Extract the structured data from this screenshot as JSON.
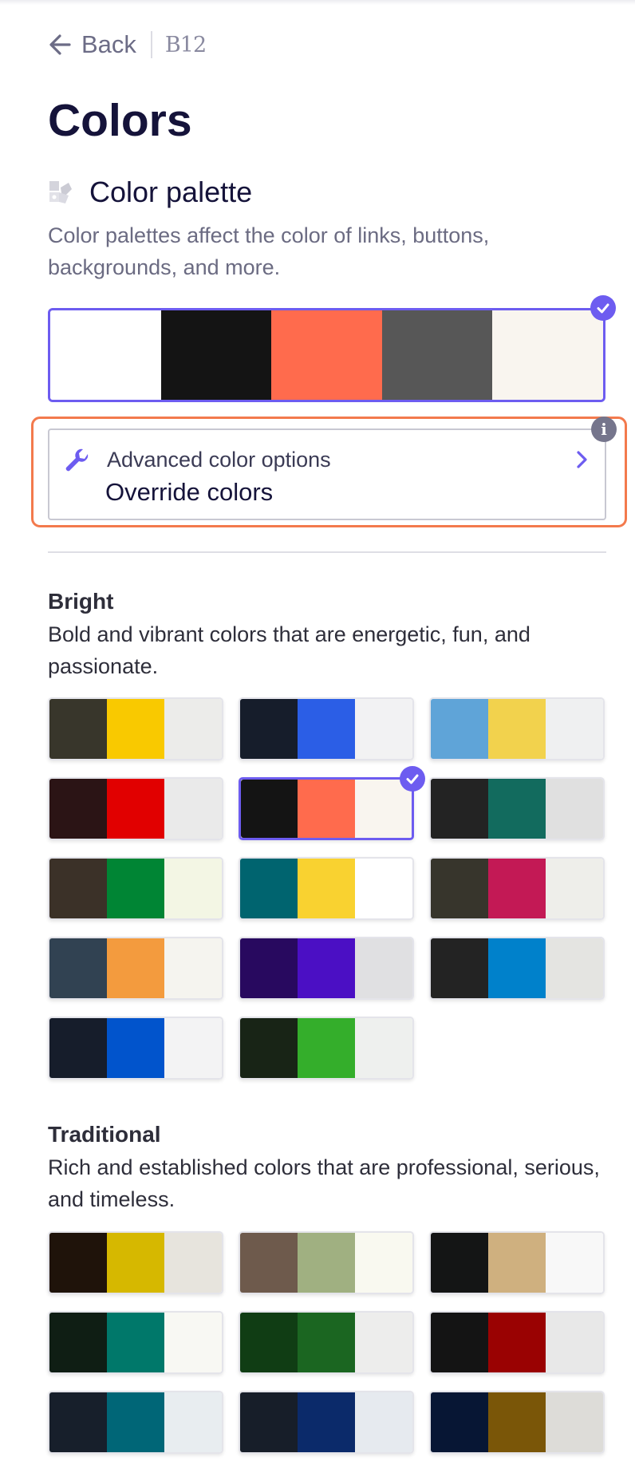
{
  "nav": {
    "back_label": "Back",
    "logo": "B12"
  },
  "page": {
    "title": "Colors"
  },
  "palette_section": {
    "icon": "paint-swatch-icon",
    "title": "Color palette",
    "description": "Color palettes affect the color of links, buttons, backgrounds, and more.",
    "selected_palette": [
      "#ffffff",
      "#141414",
      "#ff6b4d",
      "#575757",
      "#f9f5ef"
    ]
  },
  "advanced": {
    "icon": "wrench-icon",
    "label": "Advanced color options",
    "value": "Override colors",
    "info_icon": "i"
  },
  "groups": [
    {
      "title": "Bright",
      "description": "Bold and vibrant colors that are energetic, fun, and passionate.",
      "palettes": [
        {
          "colors": [
            "#38362b",
            "#f9c900",
            "#ececea"
          ],
          "selected": false
        },
        {
          "colors": [
            "#161d2b",
            "#2b5ee6",
            "#f2f2f3"
          ],
          "selected": false
        },
        {
          "colors": [
            "#5fa4d8",
            "#f2d24d",
            "#eff0f1"
          ],
          "selected": false
        },
        {
          "colors": [
            "#2b1415",
            "#e10000",
            "#eaeaea"
          ],
          "selected": false
        },
        {
          "colors": [
            "#141414",
            "#ff6b4d",
            "#f9f5ef"
          ],
          "selected": true
        },
        {
          "colors": [
            "#232323",
            "#126b5e",
            "#e0e0e0"
          ],
          "selected": false
        },
        {
          "colors": [
            "#3b3128",
            "#008534",
            "#f3f6e4"
          ],
          "selected": false
        },
        {
          "colors": [
            "#00646f",
            "#f9d230",
            "#ffffff"
          ],
          "selected": false
        },
        {
          "colors": [
            "#37352c",
            "#c31955",
            "#eeeeea"
          ],
          "selected": false
        },
        {
          "colors": [
            "#314252",
            "#f39b3e",
            "#f5f4ef"
          ],
          "selected": false
        },
        {
          "colors": [
            "#28095f",
            "#4b0fc4",
            "#e0e0e2"
          ],
          "selected": false
        },
        {
          "colors": [
            "#232323",
            "#0081cb",
            "#e4e4e1"
          ],
          "selected": false
        },
        {
          "colors": [
            "#161d2b",
            "#0154cc",
            "#f3f3f4"
          ],
          "selected": false
        },
        {
          "colors": [
            "#182416",
            "#34ae2b",
            "#eef0ee"
          ],
          "selected": false
        }
      ]
    },
    {
      "title": "Traditional",
      "description": "Rich and established colors that are professional, serious, and timeless.",
      "palettes": [
        {
          "colors": [
            "#1f130a",
            "#d6b800",
            "#e7e4dd"
          ],
          "selected": false
        },
        {
          "colors": [
            "#6e5a4c",
            "#a0b081",
            "#f9f9f0"
          ],
          "selected": false
        },
        {
          "colors": [
            "#141515",
            "#cfb07f",
            "#f8f8f8"
          ],
          "selected": false
        },
        {
          "colors": [
            "#0f1e14",
            "#00786a",
            "#f8f8f3"
          ],
          "selected": false
        },
        {
          "colors": [
            "#103d14",
            "#1b6621",
            "#ededec"
          ],
          "selected": false
        },
        {
          "colors": [
            "#141414",
            "#9a0202",
            "#e8e8e8"
          ],
          "selected": false
        },
        {
          "colors": [
            "#171f2b",
            "#006677",
            "#e8edf0"
          ],
          "selected": false
        },
        {
          "colors": [
            "#171e29",
            "#0b2a6a",
            "#e6eaef"
          ],
          "selected": false
        },
        {
          "colors": [
            "#071634",
            "#7a5608",
            "#dddcd8"
          ],
          "selected": false
        }
      ]
    }
  ]
}
